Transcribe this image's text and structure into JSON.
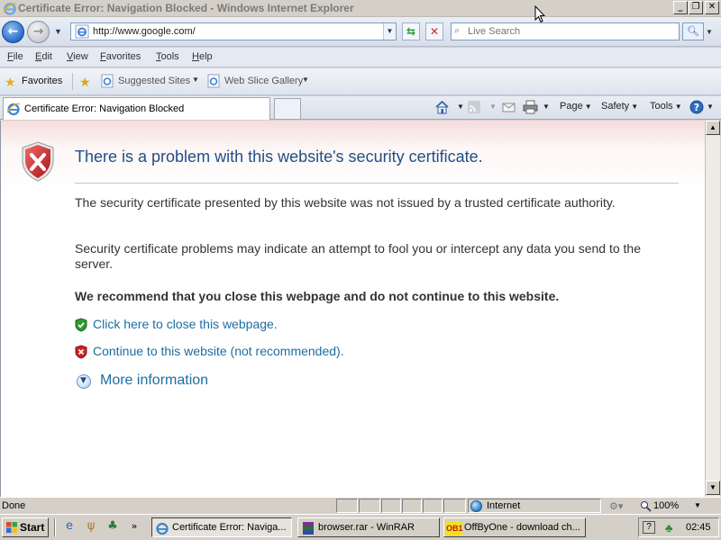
{
  "window": {
    "title": "Certificate Error: Navigation Blocked - Windows Internet Explorer",
    "controls": {
      "minimize": "_",
      "maximize": "❐",
      "close": "✕"
    }
  },
  "address_bar": {
    "url": "http://www.google.com/",
    "search_placeholder": "Live Search",
    "refresh_icon": "refresh-icon",
    "stop_icon": "stop-icon"
  },
  "menu": {
    "items": [
      "File",
      "Edit",
      "View",
      "Favorites",
      "Tools",
      "Help"
    ]
  },
  "favorites_bar": {
    "favorites_label": "Favorites",
    "links": [
      {
        "label": "Suggested Sites",
        "has_dropdown": true
      },
      {
        "label": "Web Slice Gallery",
        "has_dropdown": true
      }
    ]
  },
  "tabs": {
    "active_tab": "Certificate Error: Navigation Blocked",
    "commands": {
      "page": "Page",
      "safety": "Safety",
      "tools": "Tools"
    }
  },
  "content": {
    "heading": "There is a problem with this website's security certificate.",
    "paragraph1": "The security certificate presented by this website was not issued by a trusted certificate authority.",
    "paragraph2": "Security certificate problems may indicate an attempt to fool you or intercept any data you send to the server.",
    "recommendation": "We recommend that you close this webpage and do not continue to this website.",
    "close_link": "Click here to close this webpage.",
    "continue_link": "Continue to this website (not recommended).",
    "more_info": "More information"
  },
  "status_bar": {
    "status": "Done",
    "zone": "Internet",
    "zoom": "100%"
  },
  "taskbar": {
    "start_label": "Start",
    "tasks": [
      {
        "label": "Certificate Error: Naviga...",
        "active": true
      },
      {
        "label": "browser.rar - WinRAR",
        "active": false
      },
      {
        "label": "OffByOne - download ch...",
        "active": false,
        "icon_text": "OB1"
      }
    ],
    "clock": "02:45"
  },
  "colors": {
    "heading": "#1f4f87",
    "link": "#1c6da2",
    "shield_red": "#cc2222",
    "shield_green": "#2f9a2f",
    "page_header_tint": "#f5dcdc"
  }
}
